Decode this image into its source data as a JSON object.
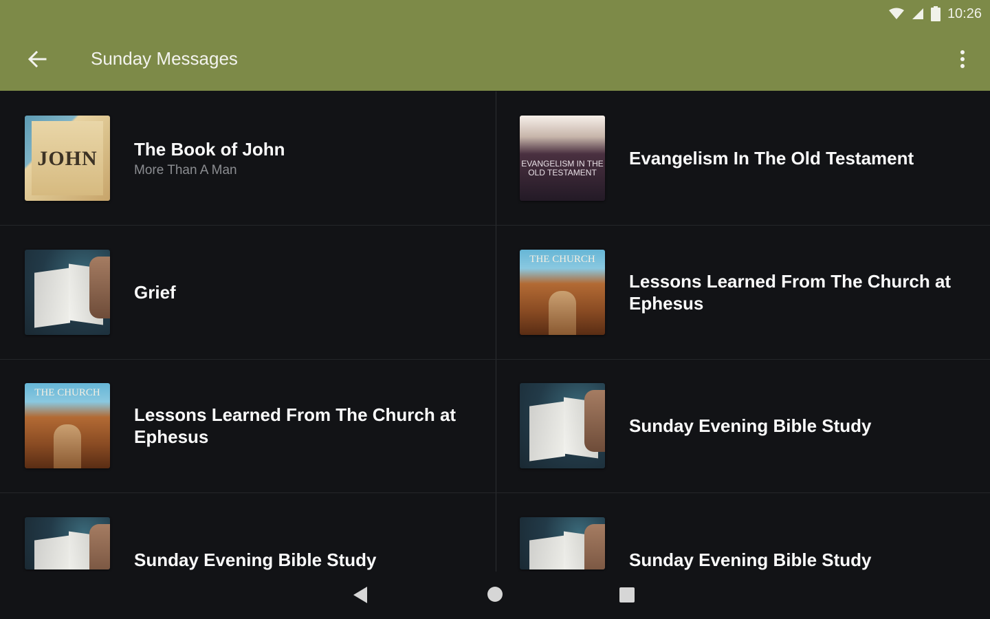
{
  "status_bar": {
    "time": "10:26",
    "wifi_icon": "wifi-icon",
    "signal_icon": "signal-icon",
    "battery_icon": "battery-icon"
  },
  "app_bar": {
    "title": "Sunday Messages",
    "back_icon": "arrow-back-icon",
    "menu_icon": "more-vert-icon",
    "color": "#7d8a48"
  },
  "items": [
    {
      "title": "The Book of John",
      "subtitle": "More Than A Man",
      "thumb_text": "JOHN",
      "thumb": "john-thumbnail"
    },
    {
      "title": "Evangelism In The Old Testament",
      "subtitle": "",
      "thumb_text": "EVANGELISM IN THE OLD TESTAMENT",
      "thumb": "evangelism-thumbnail"
    },
    {
      "title": "Grief",
      "subtitle": "",
      "thumb": "bible-thumbnail"
    },
    {
      "title": "Lessons Learned From The Church at Ephesus",
      "subtitle": "",
      "thumb_text": "THE CHURCH",
      "thumb": "church-thumbnail"
    },
    {
      "title": "Lessons Learned From The Church at Ephesus",
      "subtitle": "",
      "thumb_text": "THE CHURCH",
      "thumb": "church-thumbnail"
    },
    {
      "title": "Sunday Evening Bible Study",
      "subtitle": "",
      "thumb": "bible-thumbnail"
    },
    {
      "title": "Sunday Evening Bible Study",
      "subtitle": "",
      "thumb": "bible-thumbnail"
    },
    {
      "title": "Sunday Evening Bible Study",
      "subtitle": "",
      "thumb": "bible-thumbnail"
    }
  ],
  "nav_bar": {
    "back_icon": "nav-back-icon",
    "home_icon": "nav-home-icon",
    "recents_icon": "nav-recents-icon"
  }
}
